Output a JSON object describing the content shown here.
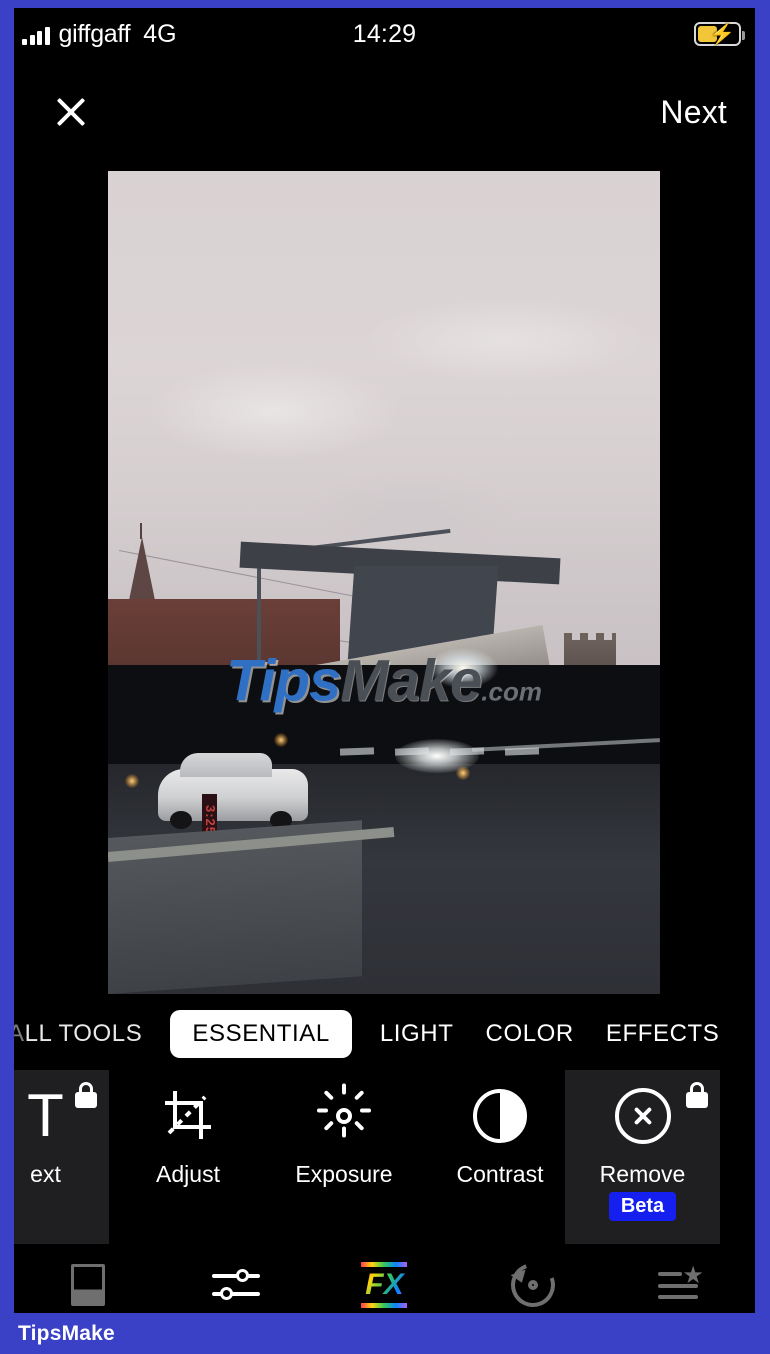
{
  "status_bar": {
    "carrier": "giffgaff",
    "network": "4G",
    "time": "14:29",
    "signal_icon": "signal-bars-icon",
    "battery_icon": "battery-charging-icon",
    "battery_color": "#f2c636",
    "battery_level_percent": 45
  },
  "top_bar": {
    "close_icon": "close-x-icon",
    "next_label": "Next"
  },
  "photo": {
    "watermark_tips": "Tips",
    "watermark_make": "Make",
    "watermark_dotcom": ".com",
    "street_sign_text": "3:25"
  },
  "tabs": {
    "items": [
      {
        "label": "ALL TOOLS",
        "label_visible": "LL TOOLS",
        "label_faded": "A",
        "active": false
      },
      {
        "label": "ESSENTIAL",
        "active": true
      },
      {
        "label": "LIGHT",
        "active": false
      },
      {
        "label": "COLOR",
        "active": false
      },
      {
        "label": "EFFECTS",
        "active": false
      }
    ]
  },
  "tools": {
    "items": [
      {
        "label": "Text",
        "label_visible": "ext",
        "icon": "text-T-icon",
        "locked": true,
        "highlighted": true
      },
      {
        "label": "Adjust",
        "icon": "crop-adjust-icon",
        "locked": false,
        "highlighted": false
      },
      {
        "label": "Exposure",
        "icon": "sun-exposure-icon",
        "locked": false,
        "highlighted": false
      },
      {
        "label": "Contrast",
        "icon": "contrast-circle-icon",
        "locked": false,
        "highlighted": false
      },
      {
        "label": "Remove",
        "icon": "remove-circle-x-icon",
        "locked": true,
        "highlighted": true,
        "badge": "Beta",
        "badge_color": "#1520f0"
      }
    ]
  },
  "bottom_nav": {
    "items": [
      {
        "icon": "photo-frame-icon",
        "active": false
      },
      {
        "icon": "sliders-adjust-icon",
        "active": true
      },
      {
        "icon": "fx-effects-icon",
        "active": false
      },
      {
        "icon": "undo-revert-icon",
        "active": false
      },
      {
        "icon": "list-star-icon",
        "active": false
      }
    ]
  },
  "footer": {
    "brand": "TipsMake",
    "brand_color": "#3b41c7"
  }
}
